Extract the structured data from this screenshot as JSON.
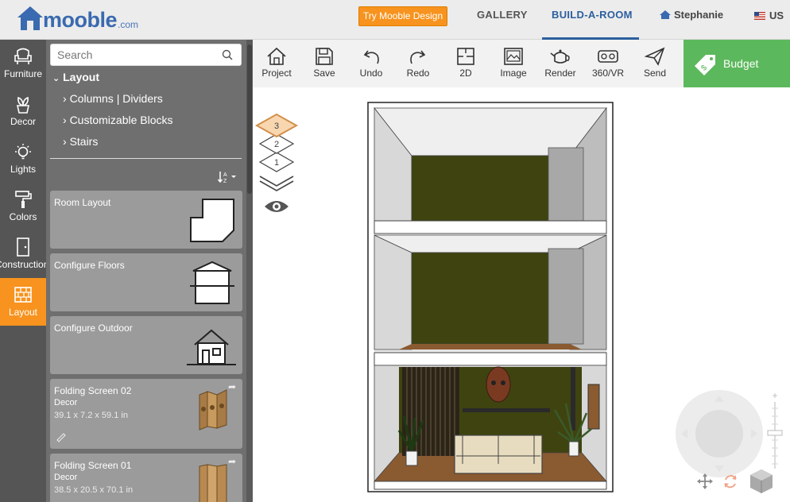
{
  "brand": {
    "name": "mooble",
    "suffix": ".com"
  },
  "header": {
    "try_button": "Try Mooble Design",
    "nav": [
      "GALLERY",
      "BUILD-A-ROOM"
    ],
    "active_nav": "BUILD-A-ROOM",
    "user": "Stephanie",
    "language": "US"
  },
  "rail": {
    "items": [
      {
        "label": "Furniture",
        "icon": "armchair-icon"
      },
      {
        "label": "Decor",
        "icon": "plant-icon"
      },
      {
        "label": "Lights",
        "icon": "bulb-icon"
      },
      {
        "label": "Colors",
        "icon": "paint-roller-icon"
      },
      {
        "label": "Construction",
        "icon": "door-icon"
      },
      {
        "label": "Layout",
        "icon": "brick-wall-icon"
      }
    ],
    "active": "Layout"
  },
  "panel": {
    "search_placeholder": "Search",
    "tree_head": "Layout",
    "tree_items": [
      "Columns | Dividers",
      "Customizable Blocks",
      "Stairs"
    ],
    "cards": [
      {
        "title": "Room Layout",
        "icon": "room-layout-icon"
      },
      {
        "title": "Configure Floors",
        "icon": "floors-icon"
      },
      {
        "title": "Configure Outdoor",
        "icon": "house-icon"
      },
      {
        "title": "Folding Screen 02",
        "category": "Decor",
        "dims": "39.1 x 7.2 x 59.1 in"
      },
      {
        "title": "Folding Screen 01",
        "category": "Decor",
        "dims": "38.5 x 20.5 x 70.1 in"
      }
    ]
  },
  "toolbar": {
    "tools": [
      "Project",
      "Save",
      "Undo",
      "Redo",
      "2D",
      "Image",
      "Render",
      "360/VR",
      "Send"
    ],
    "budget": "Budget"
  },
  "floors": {
    "levels": [
      "3",
      "2",
      "1"
    ],
    "active": "3"
  },
  "colors": {
    "accent_orange": "#f7931e",
    "brand_blue": "#3a6ab0",
    "budget_green": "#5cb85c",
    "wall_olive": "#3f4310",
    "floor_wood": "#8a5a30"
  }
}
